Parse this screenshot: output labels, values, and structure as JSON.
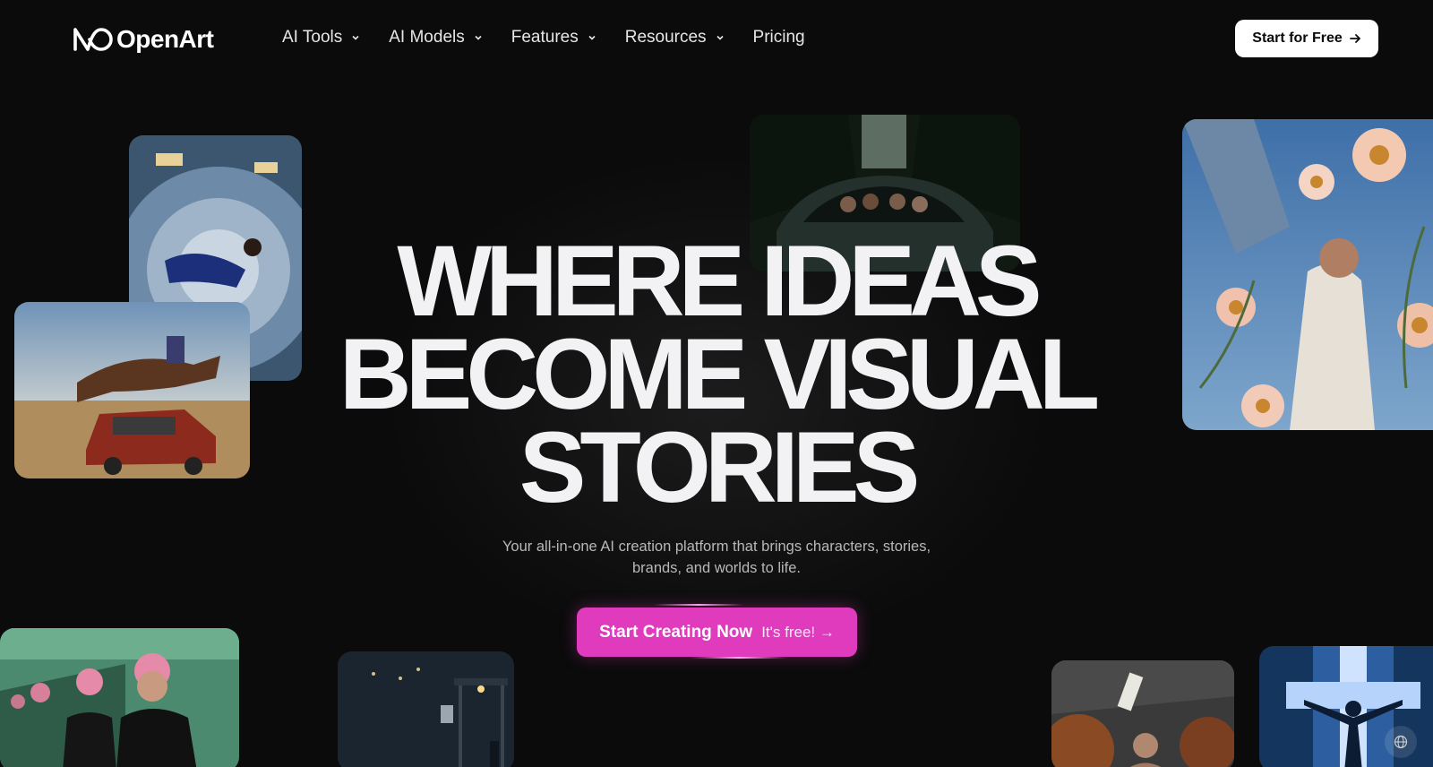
{
  "brand": {
    "name": "OpenArt",
    "logo_icon": "infinity-loop-logo-icon"
  },
  "nav": {
    "items": [
      {
        "label": "AI Tools",
        "has_dropdown": true
      },
      {
        "label": "AI Models",
        "has_dropdown": true
      },
      {
        "label": "Features",
        "has_dropdown": true
      },
      {
        "label": "Resources",
        "has_dropdown": true
      },
      {
        "label": "Pricing",
        "has_dropdown": false
      }
    ],
    "cta": {
      "label": "Start for Free",
      "icon": "arrow-right-icon"
    }
  },
  "hero": {
    "headline_lines": [
      "WHERE IDEAS",
      "BECOME VISUAL",
      "STORIES"
    ],
    "subtitle": "Your all-in-one AI creation platform that brings characters, stories, brands, and worlds to life.",
    "cta": {
      "label": "Start Creating Now",
      "secondary": "It's free! →"
    }
  },
  "gallery": [
    {
      "name": "space-station-image",
      "icon": "astronaut-image"
    },
    {
      "name": "horse-jumping-car-image",
      "icon": "horse-car-image"
    },
    {
      "name": "vintage-car-image",
      "icon": "car-image"
    },
    {
      "name": "woman-flowers-image",
      "icon": "flowers-image"
    },
    {
      "name": "pink-hair-mirror-image",
      "icon": "portrait-image"
    },
    {
      "name": "rainy-bus-stop-image",
      "icon": "street-image"
    },
    {
      "name": "basketball-image",
      "icon": "sports-image"
    },
    {
      "name": "window-light-image",
      "icon": "silhouette-image"
    }
  ],
  "colors": {
    "background": "#0b0b0b",
    "accent": "#e03bbd",
    "headline": "#f2f2f4"
  },
  "language_icon": "globe-icon"
}
